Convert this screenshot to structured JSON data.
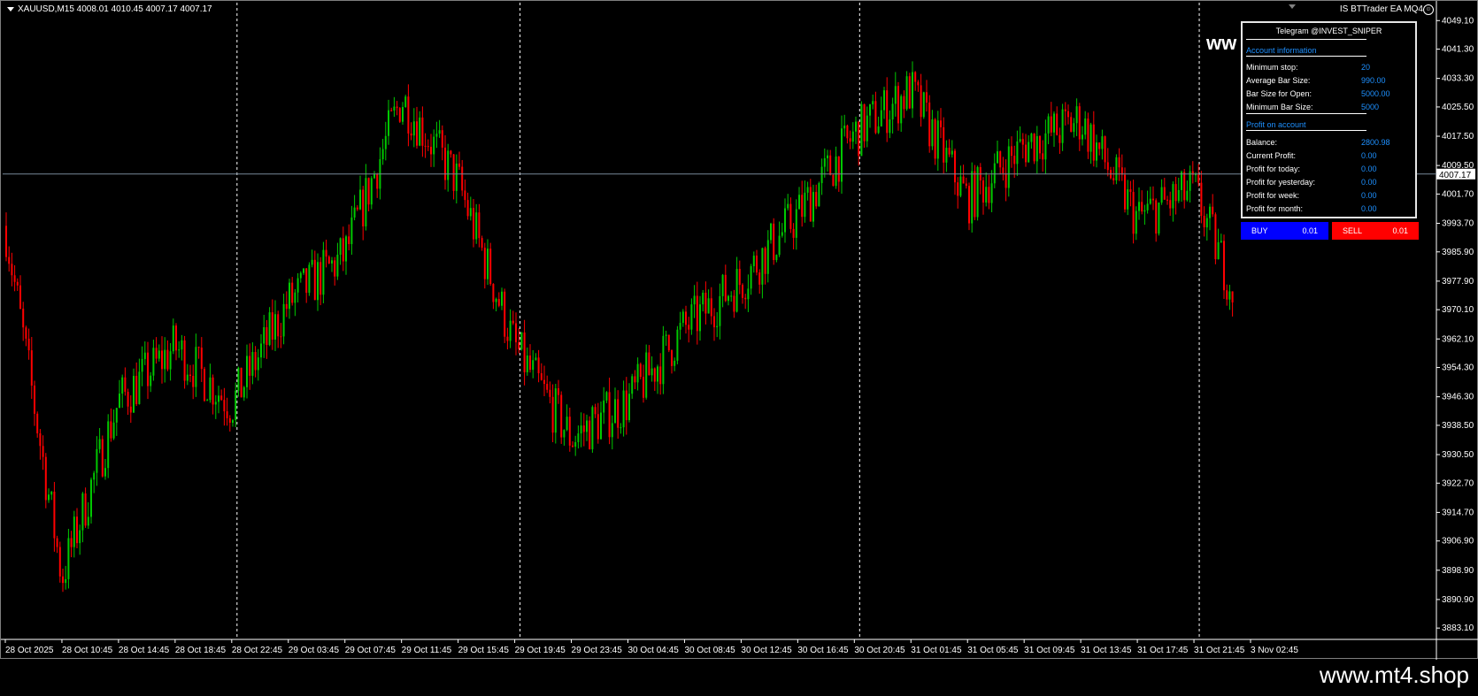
{
  "header": {
    "symbol_info": "XAUUSD,M15  4008.01 4010.45 4007.17 4007.17",
    "ea_name": "IS BTTrader EA MQ4",
    "watermark_fragment": "ww"
  },
  "panel": {
    "title": "Telegram @INVEST_SNIPER",
    "section_account": "Account information",
    "account_rows": [
      {
        "label": "Minimum stop:",
        "value": "20"
      },
      {
        "label": "Average Bar Size:",
        "value": "990.00"
      },
      {
        "label": "Bar Size for Open:",
        "value": "5000.00"
      },
      {
        "label": "Minimum Bar Size:",
        "value": "5000"
      }
    ],
    "section_profit": "Profit on account",
    "profit_rows": [
      {
        "label": "Balance:",
        "value": "2800.98"
      },
      {
        "label": "Current Profit:",
        "value": "0.00"
      },
      {
        "label": "Profit for today:",
        "value": "0.00"
      },
      {
        "label": "Profit for yesterday:",
        "value": "0.00"
      },
      {
        "label": "Profit for week:",
        "value": "0.00"
      },
      {
        "label": "Profit for month:",
        "value": "0.00"
      }
    ]
  },
  "buttons": {
    "buy_label": "BUY",
    "buy_lot": "0.01",
    "sell_label": "SELL",
    "sell_lot": "0.01"
  },
  "footer": {
    "watermark": "www.mt4.shop"
  },
  "colors": {
    "bull": "#00c800",
    "bear": "#ff0000",
    "grid": "#ffffff",
    "bid_line": "#778899",
    "accent": "#1e90ff"
  },
  "chart_data": {
    "type": "candlestick",
    "symbol": "XAUUSD",
    "timeframe": "M15",
    "ohlc_header": {
      "open": 4008.01,
      "high": 4010.45,
      "low": 4007.17,
      "close": 4007.17
    },
    "current_price": "4007.17",
    "current_price_value": 4007.17,
    "ylim": [
      3880,
      4054
    ],
    "y_ticks": [
      "4049.10",
      "4041.30",
      "4033.30",
      "4025.50",
      "4017.50",
      "4009.50",
      "4001.70",
      "3993.70",
      "3985.90",
      "3977.90",
      "3970.10",
      "3962.10",
      "3954.30",
      "3946.30",
      "3938.50",
      "3930.50",
      "3922.70",
      "3914.70",
      "3906.90",
      "3898.90",
      "3890.90",
      "3883.10"
    ],
    "y_tick_values": [
      4049.1,
      4041.3,
      4033.3,
      4025.5,
      4017.5,
      4009.5,
      4001.7,
      3993.7,
      3985.9,
      3977.9,
      3970.1,
      3962.1,
      3954.3,
      3946.3,
      3938.5,
      3930.5,
      3922.7,
      3914.7,
      3906.9,
      3898.9,
      3890.9,
      3883.1
    ],
    "x_ticks": [
      "28 Oct 2025",
      "28 Oct 10:45",
      "28 Oct 14:45",
      "28 Oct 18:45",
      "28 Oct 22:45",
      "29 Oct 03:45",
      "29 Oct 07:45",
      "29 Oct 11:45",
      "29 Oct 15:45",
      "29 Oct 19:45",
      "29 Oct 23:45",
      "30 Oct 04:45",
      "30 Oct 08:45",
      "30 Oct 12:45",
      "30 Oct 16:45",
      "30 Oct 20:45",
      "31 Oct 01:45",
      "31 Oct 05:45",
      "31 Oct 09:45",
      "31 Oct 13:45",
      "31 Oct 17:45",
      "31 Oct 21:45",
      "3 Nov 02:45"
    ],
    "day_separators": [
      "28 Oct 22:45",
      "29 Oct 19:45",
      "30 Oct 20:45",
      "31 Oct 21:45"
    ],
    "close_path": [
      [
        "28 Oct 2025",
        3993
      ],
      [
        "28 Oct 10:45",
        3897
      ],
      [
        "28 Oct 14:45",
        3945
      ],
      [
        "28 Oct 18:45",
        3960
      ],
      [
        "28 Oct 22:45",
        3944
      ],
      [
        "29 Oct 03:45",
        3972
      ],
      [
        "29 Oct 07:45",
        3985
      ],
      [
        "29 Oct 11:45",
        4028
      ],
      [
        "29 Oct 15:45",
        4005
      ],
      [
        "29 Oct 19:45",
        3960
      ],
      [
        "29 Oct 23:45",
        3935
      ],
      [
        "30 Oct 04:45",
        3945
      ],
      [
        "30 Oct 08:45",
        3965
      ],
      [
        "30 Oct 12:45",
        3978
      ],
      [
        "30 Oct 16:45",
        3996
      ],
      [
        "30 Oct 20:45",
        4018
      ],
      [
        "31 Oct 01:45",
        4030
      ],
      [
        "31 Oct 05:45",
        4000
      ],
      [
        "31 Oct 09:45",
        4015
      ],
      [
        "31 Oct 13:45",
        4022
      ],
      [
        "31 Oct 17:45",
        3995
      ],
      [
        "31 Oct 21:45",
        4003
      ],
      [
        "3 Nov 02:45",
        3975
      ]
    ],
    "grid": false
  }
}
